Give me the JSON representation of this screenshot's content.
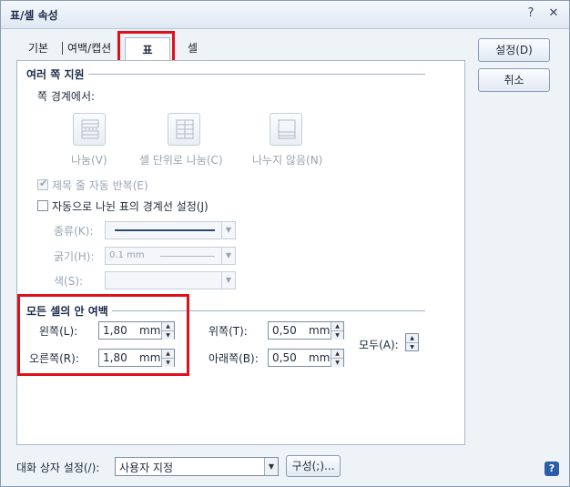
{
  "title": "표/셀 속성",
  "titlebar": {
    "help_glyph": "?",
    "close_glyph": "✕"
  },
  "tabs": [
    "기본",
    "여백/캡션",
    "표",
    "셀"
  ],
  "active_tab": "표",
  "split_section": {
    "title": "여러 쪽 지원",
    "boundary_label": "쪽 경계에서:",
    "options": [
      "나눔(V)",
      "셀 단위로 나눔(C)",
      "나누지 않음(N)"
    ]
  },
  "checkboxes": {
    "repeat_title": {
      "label": "제목 줄 자동 반복(E)",
      "checked": true,
      "enabled": false
    },
    "split_border": {
      "label": "자동으로 나뉜 표의 경계선 설정(J)",
      "checked": false,
      "enabled": true
    }
  },
  "border_fields": {
    "type_label": "종류(K):",
    "thickness_label": "굵기(H):",
    "thickness_value": "0.1 mm",
    "color_label": "색(S):"
  },
  "margins": {
    "title": "모든 셀의 안 여백",
    "left": {
      "label": "왼쪽(L):",
      "value": "1,80",
      "unit": "mm"
    },
    "right": {
      "label": "오른쪽(R):",
      "value": "1,80",
      "unit": "mm"
    },
    "top": {
      "label": "위쪽(T):",
      "value": "0,50",
      "unit": "mm"
    },
    "bottom": {
      "label": "아래쪽(B):",
      "value": "0,50",
      "unit": "mm"
    },
    "all_label": "모두(A):"
  },
  "buttons": {
    "ok": "설정(D)",
    "cancel": "취소"
  },
  "footer": {
    "dialog_setting_label": "대화 상자 설정(/):",
    "dialog_setting_value": "사용자 지정",
    "configure_button": "구성(;)...",
    "help_glyph": "?"
  },
  "colors": {
    "highlight": "#e0101a",
    "help_bg": "#2b5ea8"
  }
}
